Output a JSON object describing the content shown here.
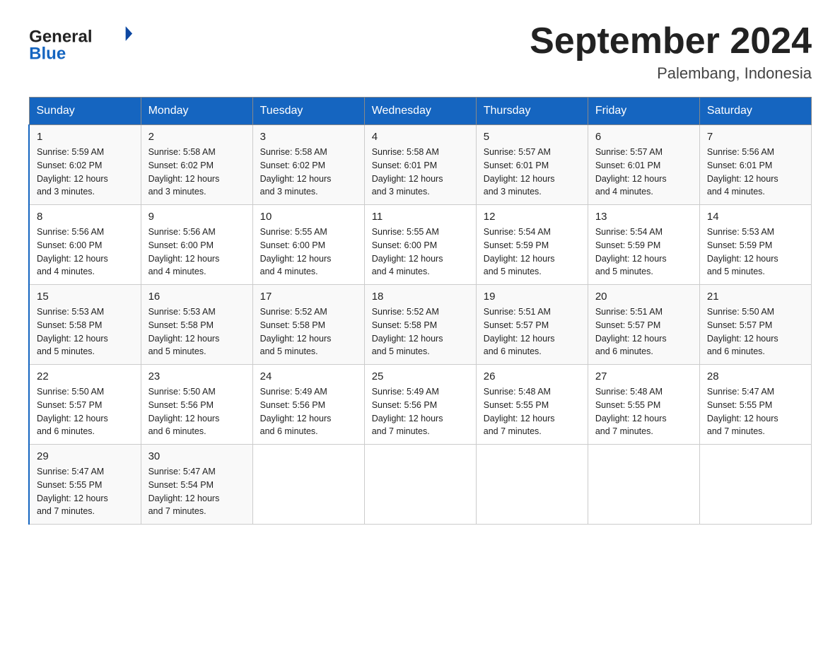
{
  "header": {
    "title": "September 2024",
    "subtitle": "Palembang, Indonesia",
    "logo_general": "General",
    "logo_blue": "Blue"
  },
  "days": [
    "Sunday",
    "Monday",
    "Tuesday",
    "Wednesday",
    "Thursday",
    "Friday",
    "Saturday"
  ],
  "weeks": [
    [
      {
        "num": "1",
        "sunrise": "5:59 AM",
        "sunset": "6:02 PM",
        "daylight": "12 hours and 3 minutes."
      },
      {
        "num": "2",
        "sunrise": "5:58 AM",
        "sunset": "6:02 PM",
        "daylight": "12 hours and 3 minutes."
      },
      {
        "num": "3",
        "sunrise": "5:58 AM",
        "sunset": "6:02 PM",
        "daylight": "12 hours and 3 minutes."
      },
      {
        "num": "4",
        "sunrise": "5:58 AM",
        "sunset": "6:01 PM",
        "daylight": "12 hours and 3 minutes."
      },
      {
        "num": "5",
        "sunrise": "5:57 AM",
        "sunset": "6:01 PM",
        "daylight": "12 hours and 3 minutes."
      },
      {
        "num": "6",
        "sunrise": "5:57 AM",
        "sunset": "6:01 PM",
        "daylight": "12 hours and 4 minutes."
      },
      {
        "num": "7",
        "sunrise": "5:56 AM",
        "sunset": "6:01 PM",
        "daylight": "12 hours and 4 minutes."
      }
    ],
    [
      {
        "num": "8",
        "sunrise": "5:56 AM",
        "sunset": "6:00 PM",
        "daylight": "12 hours and 4 minutes."
      },
      {
        "num": "9",
        "sunrise": "5:56 AM",
        "sunset": "6:00 PM",
        "daylight": "12 hours and 4 minutes."
      },
      {
        "num": "10",
        "sunrise": "5:55 AM",
        "sunset": "6:00 PM",
        "daylight": "12 hours and 4 minutes."
      },
      {
        "num": "11",
        "sunrise": "5:55 AM",
        "sunset": "6:00 PM",
        "daylight": "12 hours and 4 minutes."
      },
      {
        "num": "12",
        "sunrise": "5:54 AM",
        "sunset": "5:59 PM",
        "daylight": "12 hours and 5 minutes."
      },
      {
        "num": "13",
        "sunrise": "5:54 AM",
        "sunset": "5:59 PM",
        "daylight": "12 hours and 5 minutes."
      },
      {
        "num": "14",
        "sunrise": "5:53 AM",
        "sunset": "5:59 PM",
        "daylight": "12 hours and 5 minutes."
      }
    ],
    [
      {
        "num": "15",
        "sunrise": "5:53 AM",
        "sunset": "5:58 PM",
        "daylight": "12 hours and 5 minutes."
      },
      {
        "num": "16",
        "sunrise": "5:53 AM",
        "sunset": "5:58 PM",
        "daylight": "12 hours and 5 minutes."
      },
      {
        "num": "17",
        "sunrise": "5:52 AM",
        "sunset": "5:58 PM",
        "daylight": "12 hours and 5 minutes."
      },
      {
        "num": "18",
        "sunrise": "5:52 AM",
        "sunset": "5:58 PM",
        "daylight": "12 hours and 5 minutes."
      },
      {
        "num": "19",
        "sunrise": "5:51 AM",
        "sunset": "5:57 PM",
        "daylight": "12 hours and 6 minutes."
      },
      {
        "num": "20",
        "sunrise": "5:51 AM",
        "sunset": "5:57 PM",
        "daylight": "12 hours and 6 minutes."
      },
      {
        "num": "21",
        "sunrise": "5:50 AM",
        "sunset": "5:57 PM",
        "daylight": "12 hours and 6 minutes."
      }
    ],
    [
      {
        "num": "22",
        "sunrise": "5:50 AM",
        "sunset": "5:57 PM",
        "daylight": "12 hours and 6 minutes."
      },
      {
        "num": "23",
        "sunrise": "5:50 AM",
        "sunset": "5:56 PM",
        "daylight": "12 hours and 6 minutes."
      },
      {
        "num": "24",
        "sunrise": "5:49 AM",
        "sunset": "5:56 PM",
        "daylight": "12 hours and 6 minutes."
      },
      {
        "num": "25",
        "sunrise": "5:49 AM",
        "sunset": "5:56 PM",
        "daylight": "12 hours and 7 minutes."
      },
      {
        "num": "26",
        "sunrise": "5:48 AM",
        "sunset": "5:55 PM",
        "daylight": "12 hours and 7 minutes."
      },
      {
        "num": "27",
        "sunrise": "5:48 AM",
        "sunset": "5:55 PM",
        "daylight": "12 hours and 7 minutes."
      },
      {
        "num": "28",
        "sunrise": "5:47 AM",
        "sunset": "5:55 PM",
        "daylight": "12 hours and 7 minutes."
      }
    ],
    [
      {
        "num": "29",
        "sunrise": "5:47 AM",
        "sunset": "5:55 PM",
        "daylight": "12 hours and 7 minutes."
      },
      {
        "num": "30",
        "sunrise": "5:47 AM",
        "sunset": "5:54 PM",
        "daylight": "12 hours and 7 minutes."
      },
      null,
      null,
      null,
      null,
      null
    ]
  ],
  "labels": {
    "sunrise": "Sunrise:",
    "sunset": "Sunset:",
    "daylight": "Daylight:"
  }
}
